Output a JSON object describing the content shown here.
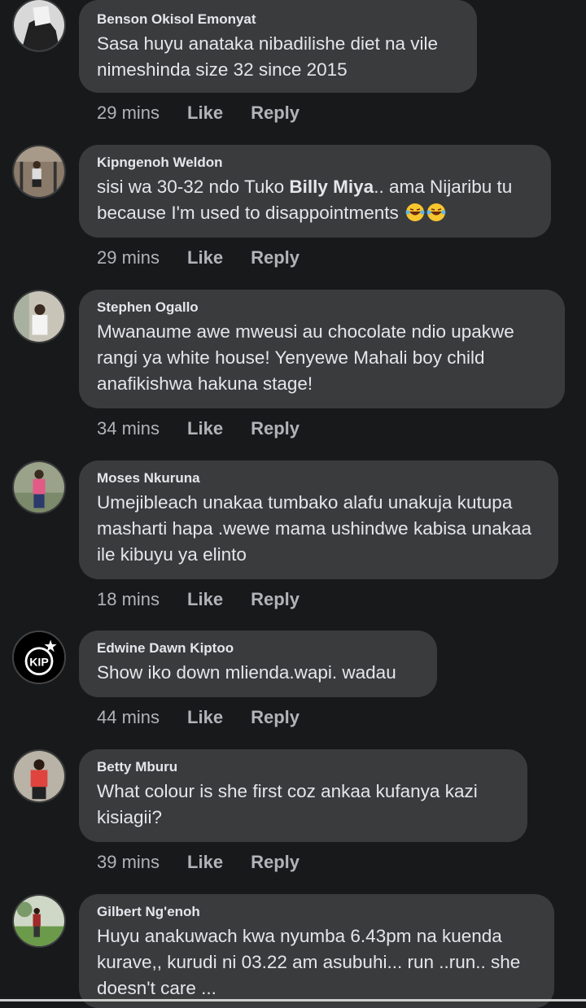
{
  "comments": [
    {
      "author": "Benson Okisol Emonyat",
      "text": "Sasa huyu anataka nibadilishe diet na vile nimeshinda size 32 since 2015",
      "time": "29 mins",
      "like": "Like",
      "reply": "Reply"
    },
    {
      "author": "Kipngenoh Weldon",
      "text_pre": "sisi wa 30-32 ndo Tuko ",
      "mention": "Billy Miya",
      "text_post": ".. ama Nijaribu tu because I'm used to disappointments",
      "emoji": "laughing-tears-emoji",
      "time": "29 mins",
      "like": "Like",
      "reply": "Reply"
    },
    {
      "author": "Stephen Ogallo",
      "text": "Mwanaume awe mweusi au chocolate ndio upakwe rangi ya white house! Yenyewe Mahali boy child anafikishwa hakuna stage!",
      "time": "34 mins",
      "like": "Like",
      "reply": "Reply"
    },
    {
      "author": "Moses Nkuruna",
      "text": "Umejibleach unakaa tumbako alafu unakuja kutupa masharti hapa .wewe mama ushindwe kabisa unakaa ile kibuyu ya elinto",
      "time": "18 mins",
      "like": "Like",
      "reply": "Reply"
    },
    {
      "author": "Edwine Dawn Kiptoo",
      "text": "Show iko down mlienda.wapi. wadau",
      "avatar_text": "KIP",
      "time": "44 mins",
      "like": "Like",
      "reply": "Reply"
    },
    {
      "author": "Betty Mburu",
      "text": "What colour  is she first coz ankaa kufanya kazi kisiagii?",
      "time": "39 mins",
      "like": "Like",
      "reply": "Reply"
    },
    {
      "author": "Gilbert Ng'enoh",
      "text": "Huyu anakuwach kwa nyumba 6.43pm na kuenda kurave,, kurudi ni 03.22 am asubuhi... run ..run.. she doesn't care ..."
    }
  ],
  "colors": {
    "background": "#18191a",
    "bubble": "#3a3b3c",
    "text": "#e4e6eb",
    "secondary": "#b0b3b8"
  }
}
